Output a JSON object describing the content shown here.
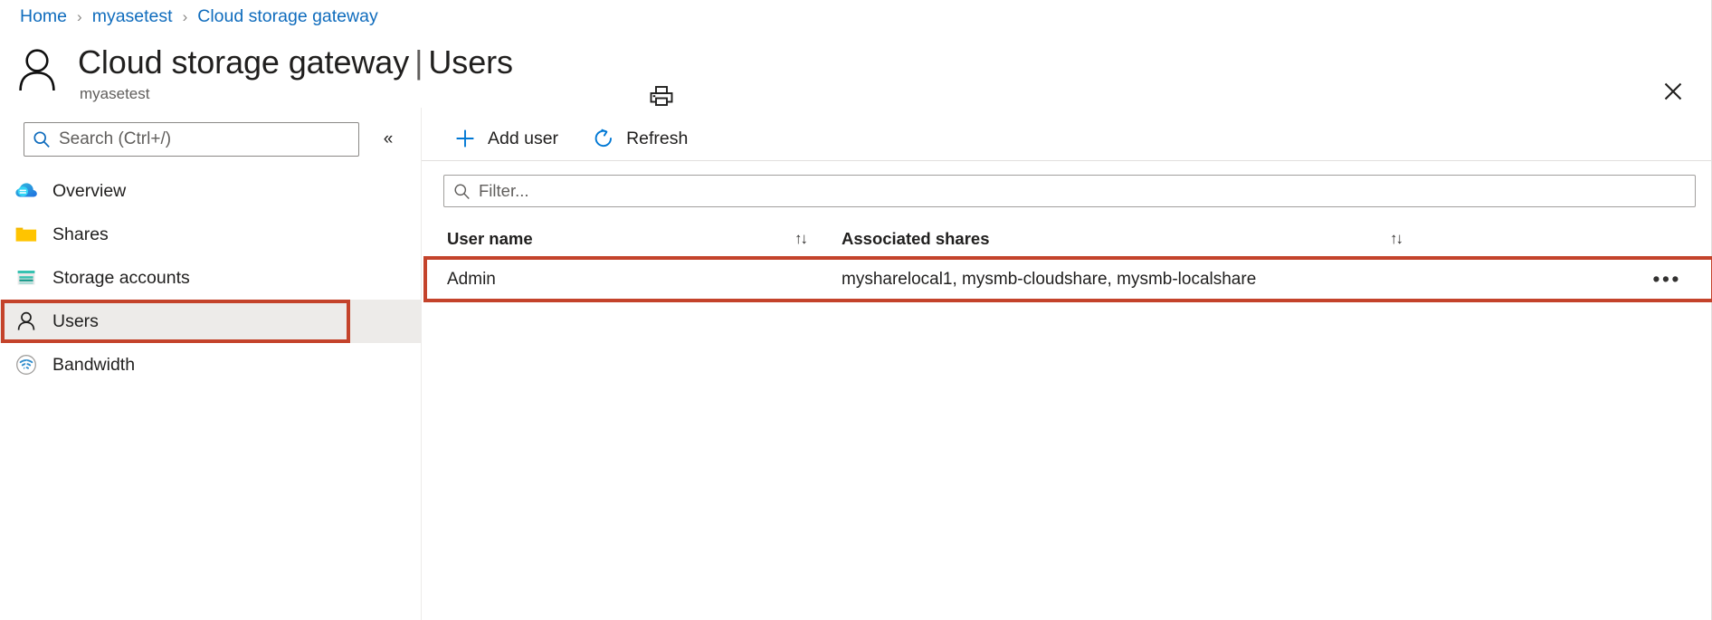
{
  "colors": {
    "link": "#0f6cbd",
    "annotation_red": "#c4432b",
    "accent_blue": "#0078d4",
    "text_primary": "#201f1e",
    "text_secondary": "#605e5c",
    "selected_row_bg": "#edebe9"
  },
  "breadcrumb": {
    "items": [
      {
        "label": "Home"
      },
      {
        "label": "myasetest"
      },
      {
        "label": "Cloud storage gateway"
      }
    ],
    "separator": "›"
  },
  "header": {
    "avatar_icon": "user-outline-icon",
    "resource_name": "Cloud storage gateway",
    "separator": "|",
    "page_name": "Users",
    "subtitle": "myasetest",
    "print_icon": "printer-icon",
    "close_icon": "close-icon"
  },
  "sidebar": {
    "search": {
      "placeholder": "Search (Ctrl+/)",
      "value": "",
      "icon": "search-icon"
    },
    "collapse": {
      "icon": "chevron-double-left-icon",
      "glyph": "«"
    },
    "items": [
      {
        "label": "Overview",
        "icon": "cloud-icon",
        "selected": false,
        "annotated": false
      },
      {
        "label": "Shares",
        "icon": "folder-icon",
        "selected": false,
        "annotated": false
      },
      {
        "label": "Storage accounts",
        "icon": "storage-account-icon",
        "selected": false,
        "annotated": false
      },
      {
        "label": "Users",
        "icon": "user-outline-icon",
        "selected": true,
        "annotated": true
      },
      {
        "label": "Bandwidth",
        "icon": "bandwidth-wifi-icon",
        "selected": false,
        "annotated": false
      }
    ]
  },
  "toolbar": {
    "buttons": [
      {
        "label": "Add user",
        "icon": "plus-icon"
      },
      {
        "label": "Refresh",
        "icon": "refresh-icon"
      }
    ]
  },
  "filter": {
    "placeholder": "Filter...",
    "value": "",
    "icon": "search-icon"
  },
  "table": {
    "columns": [
      {
        "label": "User name",
        "sortable": true,
        "sort_glyph": "↑↓"
      },
      {
        "label": "Associated shares",
        "sortable": true,
        "sort_glyph": "↑↓"
      }
    ],
    "rows": [
      {
        "user_name": "Admin",
        "associated_shares": "mysharelocal1, mysmb-cloudshare, mysmb-localshare",
        "row_menu_glyph": "•••",
        "annotated": true
      }
    ]
  }
}
